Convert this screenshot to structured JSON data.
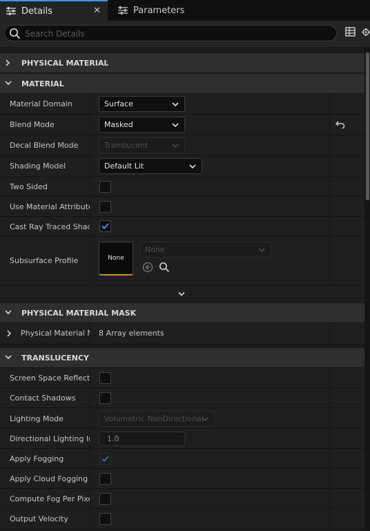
{
  "tabs": {
    "details_label": "Details",
    "close_glyph": "✕",
    "parameters_label": "Parameters",
    "details_icon": "details-sliders-icon",
    "parameters_icon": "parameters-sliders-icon"
  },
  "search": {
    "placeholder": "Search Details",
    "icon": "search-icon"
  },
  "toolbar": {
    "table_icon": "table-view-icon",
    "settings_icon": "gear-icon"
  },
  "sections": {
    "physical_material": "PHYSICAL MATERIAL",
    "material": "MATERIAL",
    "physical_material_mask": "PHYSICAL MATERIAL MASK",
    "translucency": "TRANSLUCENCY"
  },
  "material": {
    "material_domain": {
      "label": "Material Domain",
      "value": "Surface"
    },
    "blend_mode": {
      "label": "Blend Mode",
      "value": "Masked",
      "reset_icon": "reset-to-default-icon"
    },
    "decal_blend_mode": {
      "label": "Decal Blend Mode",
      "value": "Translucent",
      "enabled": false
    },
    "shading_model": {
      "label": "Shading Model",
      "value": "Default Lit"
    },
    "two_sided": {
      "label": "Two Sided",
      "checked": false
    },
    "use_material_attributes": {
      "label": "Use Material Attributes",
      "checked": false
    },
    "cast_ray_traced_shadows": {
      "label": "Cast Ray Traced Shadows",
      "checked": true
    },
    "subsurface_profile": {
      "label": "Subsurface Profile",
      "thumbnail": "None",
      "value": "None",
      "enabled": false
    }
  },
  "physical_material_mask": {
    "label": "Physical Material Mask",
    "value": "8 Array elements"
  },
  "translucency": {
    "screen_space_reflections": {
      "label": "Screen Space Reflections",
      "checked": false
    },
    "contact_shadows": {
      "label": "Contact Shadows",
      "checked": false
    },
    "lighting_mode": {
      "label": "Lighting Mode",
      "value": "Volumetric NonDirectional",
      "enabled": false
    },
    "directional_lighting_intensity": {
      "label": "Directional Lighting Intensity",
      "value": "1.0"
    },
    "apply_fogging": {
      "label": "Apply Fogging",
      "checked": true,
      "enabled": false
    },
    "apply_cloud_fogging": {
      "label": "Apply Cloud Fogging",
      "checked": false
    },
    "compute_fog_per_pixel": {
      "label": "Compute Fog Per Pixel",
      "checked": false
    },
    "output_velocity": {
      "label": "Output Velocity",
      "checked": false
    }
  },
  "colors": {
    "accent": "#4f8fd6",
    "check_mark": "#4f8fd6",
    "thumbnail_underline": "#d08a3a"
  }
}
